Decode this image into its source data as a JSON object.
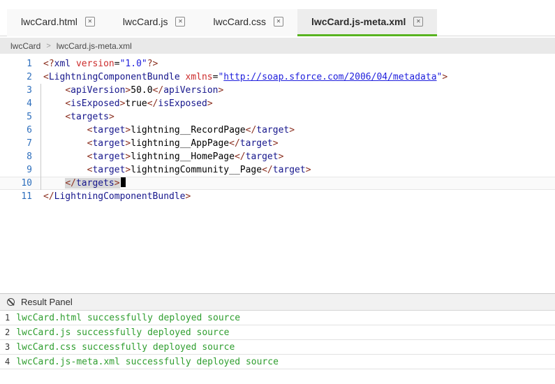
{
  "icons": {
    "close": "✕",
    "breadcrumb_separator": ">",
    "result_clear": "ban-circle"
  },
  "colors": {
    "accent_green": "#58b320",
    "message_green": "#2f9e2f",
    "line_number_blue": "#2e6fbd",
    "tag_navy": "#16168c",
    "bracket_maroon": "#8b2f1f",
    "attr_red": "#cc2b2b",
    "value_blue": "#2020dd"
  },
  "tabs": [
    {
      "label": "lwcCard.html",
      "active": false
    },
    {
      "label": "lwcCard.js",
      "active": false
    },
    {
      "label": "lwcCard.css",
      "active": false
    },
    {
      "label": "lwcCard.js-meta.xml",
      "active": true
    }
  ],
  "breadcrumb": {
    "folder": "lwcCard",
    "file": "lwcCard.js-meta.xml"
  },
  "editor": {
    "lines": [
      {
        "num": 1,
        "tokens": [
          [
            "b",
            "<?"
          ],
          [
            "n",
            "xml"
          ],
          [
            "x",
            " "
          ],
          [
            "a",
            "version"
          ],
          [
            "p",
            "="
          ],
          [
            "q",
            "\"1.0\""
          ],
          [
            "b",
            "?>"
          ]
        ]
      },
      {
        "num": 2,
        "tokens": [
          [
            "b",
            "<"
          ],
          [
            "n",
            "LightningComponentBundle"
          ],
          [
            "x",
            " "
          ],
          [
            "a",
            "xmlns"
          ],
          [
            "p",
            "="
          ],
          [
            "q",
            "\""
          ],
          [
            "u",
            "http://soap.sforce.com/2006/04/metadata"
          ],
          [
            "q",
            "\""
          ],
          [
            "b",
            ">"
          ]
        ]
      },
      {
        "num": 3,
        "tokens": [
          [
            "x",
            "    "
          ],
          [
            "b",
            "<"
          ],
          [
            "n",
            "apiVersion"
          ],
          [
            "b",
            ">"
          ],
          [
            "x",
            "50.0"
          ],
          [
            "b",
            "</"
          ],
          [
            "n",
            "apiVersion"
          ],
          [
            "b",
            ">"
          ]
        ]
      },
      {
        "num": 4,
        "tokens": [
          [
            "x",
            "    "
          ],
          [
            "b",
            "<"
          ],
          [
            "n",
            "isExposed"
          ],
          [
            "b",
            ">"
          ],
          [
            "x",
            "true"
          ],
          [
            "b",
            "</"
          ],
          [
            "n",
            "isExposed"
          ],
          [
            "b",
            ">"
          ]
        ]
      },
      {
        "num": 5,
        "tokens": [
          [
            "x",
            "    "
          ],
          [
            "b",
            "<"
          ],
          [
            "n",
            "targets"
          ],
          [
            "b",
            ">"
          ]
        ]
      },
      {
        "num": 6,
        "tokens": [
          [
            "x",
            "        "
          ],
          [
            "b",
            "<"
          ],
          [
            "n",
            "target"
          ],
          [
            "b",
            ">"
          ],
          [
            "x",
            "lightning__RecordPage"
          ],
          [
            "b",
            "</"
          ],
          [
            "n",
            "target"
          ],
          [
            "b",
            ">"
          ]
        ]
      },
      {
        "num": 7,
        "tokens": [
          [
            "x",
            "        "
          ],
          [
            "b",
            "<"
          ],
          [
            "n",
            "target"
          ],
          [
            "b",
            ">"
          ],
          [
            "x",
            "lightning__AppPage"
          ],
          [
            "b",
            "</"
          ],
          [
            "n",
            "target"
          ],
          [
            "b",
            ">"
          ]
        ]
      },
      {
        "num": 8,
        "tokens": [
          [
            "x",
            "        "
          ],
          [
            "b",
            "<"
          ],
          [
            "n",
            "target"
          ],
          [
            "b",
            ">"
          ],
          [
            "x",
            "lightning__HomePage"
          ],
          [
            "b",
            "</"
          ],
          [
            "n",
            "target"
          ],
          [
            "b",
            ">"
          ]
        ]
      },
      {
        "num": 9,
        "tokens": [
          [
            "x",
            "        "
          ],
          [
            "b",
            "<"
          ],
          [
            "n",
            "target"
          ],
          [
            "b",
            ">"
          ],
          [
            "x",
            "lightningCommunity__Page"
          ],
          [
            "b",
            "</"
          ],
          [
            "n",
            "target"
          ],
          [
            "b",
            ">"
          ]
        ]
      },
      {
        "num": 10,
        "active": true,
        "tokens": [
          [
            "x",
            "    "
          ],
          [
            "hb",
            "</"
          ],
          [
            "hn",
            "targets"
          ],
          [
            "hb",
            ">"
          ],
          [
            "cr",
            ""
          ]
        ]
      },
      {
        "num": 11,
        "tokens": [
          [
            "b",
            "</"
          ],
          [
            "n",
            "LightningComponentBundle"
          ],
          [
            "b",
            ">"
          ]
        ]
      }
    ]
  },
  "result_panel": {
    "title": "Result Panel",
    "rows": [
      {
        "num": 1,
        "text": "lwcCard.html successfully deployed source"
      },
      {
        "num": 2,
        "text": "lwcCard.js successfully deployed source"
      },
      {
        "num": 3,
        "text": "lwcCard.css successfully deployed source"
      },
      {
        "num": 4,
        "text": "lwcCard.js-meta.xml successfully deployed source"
      }
    ]
  }
}
